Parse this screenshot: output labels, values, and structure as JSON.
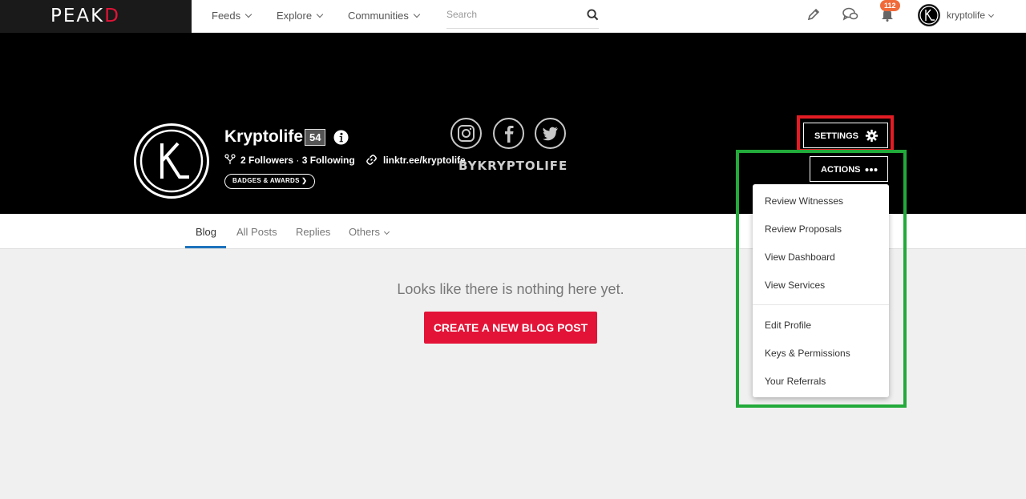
{
  "topbar": {
    "logo_left": "PEAK",
    "logo_right": "D",
    "nav": [
      "Feeds",
      "Explore",
      "Communities"
    ],
    "search_placeholder": "Search",
    "notifications_count": "112",
    "username": "kryptolife"
  },
  "profile": {
    "name": "Kryptolife",
    "reputation": "54",
    "followers": "2 Followers",
    "separator": " · ",
    "following": "3 Following",
    "link": "linktr.ee/kryptolife",
    "badges_label": "BADGES & AWARDS",
    "banner_text": "BYKRYPTOLIFE",
    "settings_label": "SETTINGS",
    "actions_label": "ACTIONS"
  },
  "tabs": [
    "Blog",
    "All Posts",
    "Replies",
    "Others"
  ],
  "main": {
    "empty_message": "Looks like there is nothing here yet.",
    "create_button": "CREATE A NEW BLOG POST"
  },
  "actions_menu": {
    "group1": [
      "Review Witnesses",
      "Review Proposals",
      "View Dashboard",
      "View Services"
    ],
    "group2": [
      "Edit Profile",
      "Keys & Permissions",
      "Your Referrals"
    ]
  },
  "colors": {
    "brand_red": "#e31337",
    "annotation_red": "#e31c24",
    "annotation_green": "#22aa3a",
    "tab_active": "#1e73be",
    "badge_orange": "#f06a3a"
  },
  "icons": [
    "pencil-icon",
    "chat-icon",
    "bell-icon",
    "gear-icon",
    "dots-icon",
    "info-icon",
    "link-icon",
    "users-icon",
    "instagram-icon",
    "facebook-icon",
    "twitter-icon",
    "search-icon"
  ]
}
